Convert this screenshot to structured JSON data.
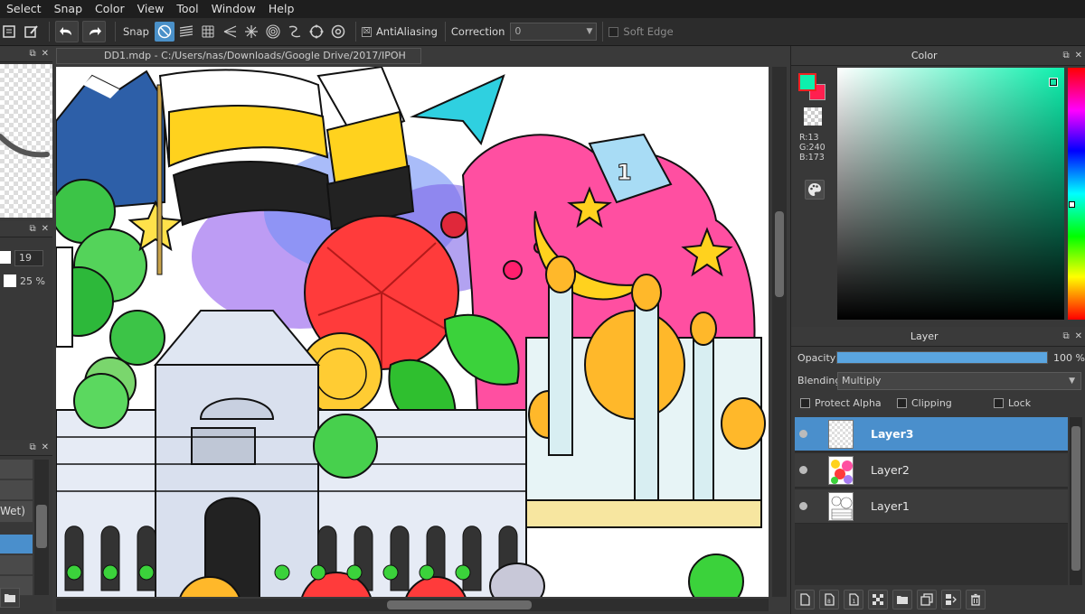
{
  "menu": [
    "Select",
    "Snap",
    "Color",
    "View",
    "Tool",
    "Window",
    "Help"
  ],
  "toolbar": {
    "snap_label": "Snap",
    "antialiasing_label": "AntiAliasing",
    "antialiasing_checked": "☒",
    "correction_label": "Correction",
    "correction_value": "0",
    "soft_edge_label": "Soft Edge"
  },
  "left_panel": {
    "field_size": "19",
    "field_opacity": "25 %",
    "list_item_wet": "Wet)"
  },
  "document": {
    "tab_title": "DD1.mdp - C:/Users/nas/Downloads/Google Drive/2017/IPOH"
  },
  "color": {
    "panel_title": "Color",
    "foreground": "#0df0ad",
    "background": "#ff1f4f",
    "r": "R:13",
    "g": "G:240",
    "b": "B:173"
  },
  "layer": {
    "panel_title": "Layer",
    "opacity_label": "Opacity",
    "opacity_value": "100 %",
    "opacity_fraction": 1.0,
    "blending_label": "Blending",
    "blending_value": "Multiply",
    "protect_alpha": "Protect Alpha",
    "clipping": "Clipping",
    "lock": "Lock",
    "layers": [
      {
        "name": "Layer3",
        "selected": true
      },
      {
        "name": "Layer2",
        "selected": false
      },
      {
        "name": "Layer1",
        "selected": false
      }
    ]
  },
  "icons": {
    "panel_popout": "⧉",
    "panel_close": "✕"
  }
}
